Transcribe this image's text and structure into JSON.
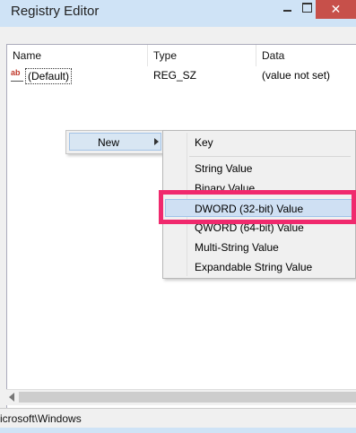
{
  "window": {
    "title": "Registry Editor",
    "close_glyph": "✕"
  },
  "columns": {
    "name": "Name",
    "type": "Type",
    "data": "Data"
  },
  "rows": [
    {
      "icon": "ab",
      "name": "(Default)",
      "type": "REG_SZ",
      "data": "(value not set)"
    }
  ],
  "context_menu": {
    "new_label": "New"
  },
  "submenu": {
    "items": [
      "Key",
      "String Value",
      "Binary Value",
      "DWORD (32-bit) Value",
      "QWORD (64-bit) Value",
      "Multi-String Value",
      "Expandable String Value"
    ],
    "highlighted": "DWORD (32-bit) Value"
  },
  "status": {
    "path": "icrosoft\\Windows"
  },
  "colors": {
    "highlight_box": "#f0296d",
    "titlebar": "#cfe3f6",
    "close_button": "#c7504a"
  }
}
